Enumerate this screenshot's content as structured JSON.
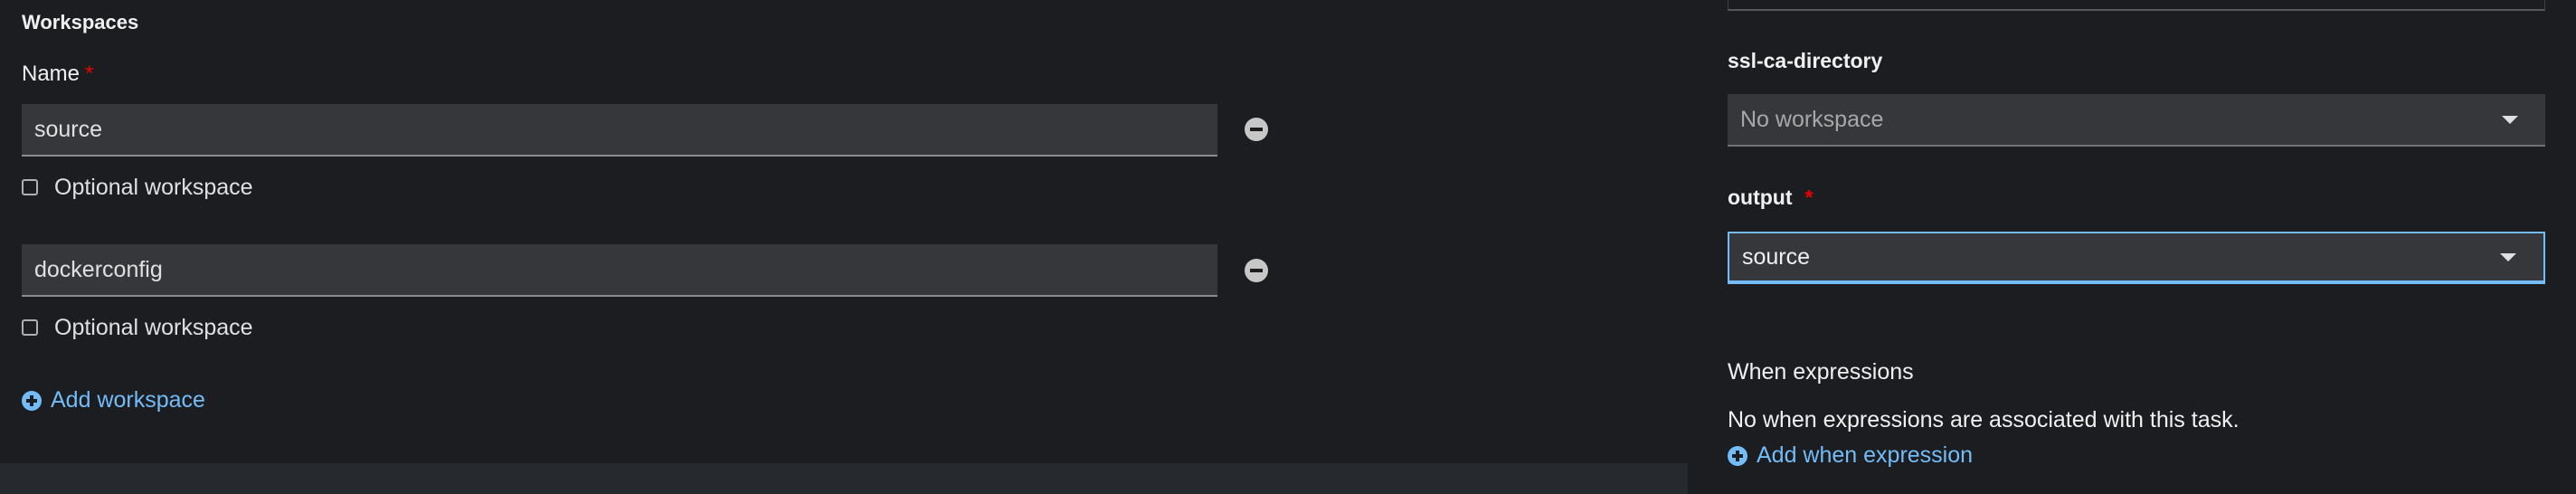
{
  "workspaces": {
    "title": "Workspaces",
    "name_label": "Name",
    "required_mark": "*",
    "items": [
      {
        "value": "source",
        "optional_label": "Optional workspace"
      },
      {
        "value": "dockerconfig",
        "optional_label": "Optional workspace"
      }
    ],
    "add_label": "Add workspace"
  },
  "task_panel": {
    "ssl_ca_directory": {
      "label": "ssl-ca-directory",
      "value": "No workspace"
    },
    "output": {
      "label": "output",
      "required_mark": "*",
      "value": "source"
    },
    "when": {
      "title": "When expressions",
      "empty_text": "No when expressions are associated with this task.",
      "add_label": "Add when expression"
    }
  },
  "colors": {
    "background": "#1b1d21",
    "input_bg": "#36373a",
    "link": "#73bcf7",
    "required": "#ee0000"
  },
  "icons": [
    "minus-circle-icon",
    "plus-circle-icon",
    "caret-down-icon"
  ]
}
